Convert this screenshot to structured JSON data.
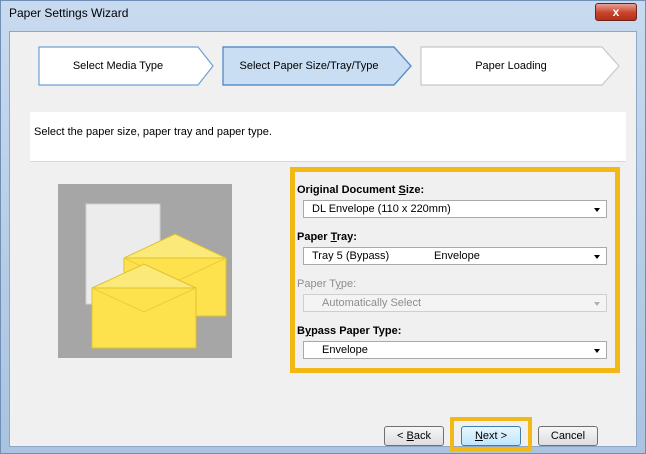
{
  "window": {
    "title": "Paper Settings Wizard",
    "close_label": "x"
  },
  "steps": [
    {
      "label": "Select Media Type",
      "state": "done"
    },
    {
      "label": "Select Paper Size/Tray/Type",
      "state": "current"
    },
    {
      "label": "Paper Loading",
      "state": "pending"
    }
  ],
  "instruction": "Select the paper size, paper tray and paper type.",
  "fields": {
    "size": {
      "label_pre": "Original Document ",
      "label_key": "S",
      "label_post": "ize:",
      "value": "DL Envelope (110 x 220mm)"
    },
    "tray": {
      "label_pre": "Paper ",
      "label_key": "T",
      "label_post": "ray:",
      "value": "Tray 5 (Bypass)",
      "value2": "Envelope"
    },
    "type": {
      "label_pre": "Paper T",
      "label_key": "y",
      "label_post": "pe:",
      "value": "Automatically Select",
      "disabled": true
    },
    "bypass": {
      "label_pre": "B",
      "label_key": "y",
      "label_post": "pass Paper Type:",
      "value": "Envelope"
    }
  },
  "buttons": {
    "back": {
      "pre": "< ",
      "key": "B",
      "post": "ack"
    },
    "next": {
      "pre": "",
      "key": "N",
      "post": "ext >"
    },
    "cancel": "Cancel"
  },
  "colors": {
    "highlight": "#f2b816",
    "envelope_yellow": "#fde24e",
    "current_step": "#c9ddf3"
  }
}
